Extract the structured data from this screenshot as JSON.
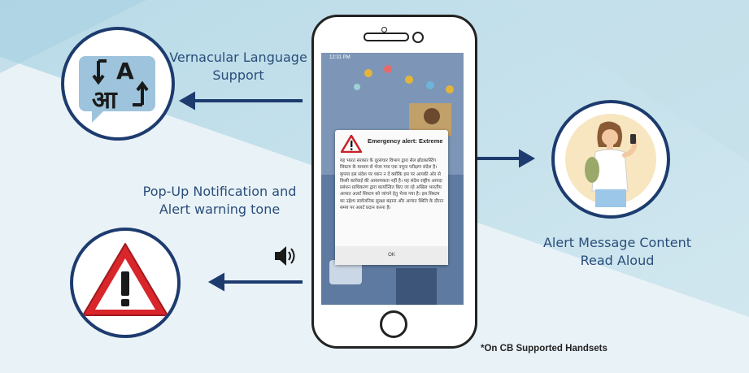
{
  "labels": {
    "vernacular": [
      "Vernacular Language",
      "Support"
    ],
    "popup": [
      "Pop-Up Notification and",
      "Alert warning tone"
    ],
    "readaloud": [
      "Alert Message Content",
      "Read Aloud"
    ]
  },
  "footnote": "*On CB Supported Handsets",
  "phone": {
    "status_time": "12:31 PM",
    "alert_title": "Emergency alert: Extreme",
    "alert_body": "यह भारत सरकार के दूरसंचार विभाग द्वारा सेल ब्रॉडकास्टिंग सिस्टम के माध्यम से भेजा गया एक नमूना परीक्षण संदेश है। कृपया इस संदेश पर ध्यान न दें क्योंकि इस पर आपकी ओर से किसी कार्रवाई की आवश्यकता नहीं है। यह संदेश राष्ट्रीय आपदा प्रबंधन प्राधिकरण द्वारा कार्यान्वित किए जा रहे अखिल भारतीय आपात अलर्ट सिस्टम को जांचने हेतु भेजा गया है। इस सिस्टम का उद्देश्य सार्वजनिक सुरक्षा बढ़ाना और आपात स्थिति के दौरान समय पर अलर्ट प्रदान करना है।",
    "ok_label": "OK"
  },
  "icons": {
    "language_glyphs": [
      "A",
      "आ"
    ]
  },
  "colors": {
    "navy": "#1d3b6e",
    "label_blue": "#2a4e7a",
    "warning_red": "#d8262b"
  }
}
